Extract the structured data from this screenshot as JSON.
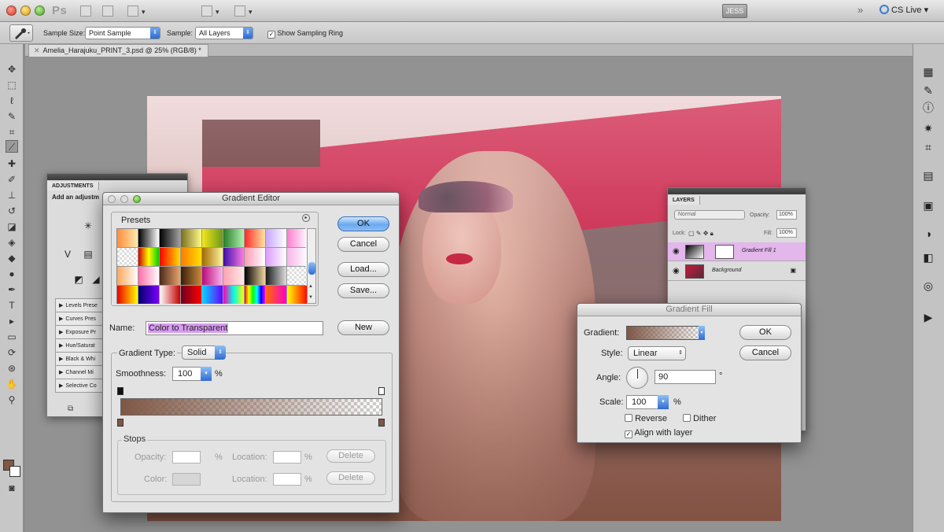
{
  "app": {
    "logo": "Ps",
    "workspace": "JESS",
    "cs_live": "CS Live"
  },
  "options_bar": {
    "sample_size_label": "Sample Size:",
    "sample_size_value": "Point Sample",
    "sample_label": "Sample:",
    "sample_value": "All Layers",
    "show_sampling_ring": "Show Sampling Ring",
    "show_sampling_ring_checked": true
  },
  "document": {
    "tab_title": "Amelia_Harajuku_PRINT_3.psd @ 25% (RGB/8) *"
  },
  "adjustments": {
    "tab": "ADJUSTMENTS",
    "hint": "Add an adjustm",
    "presets": [
      "Levels Prese",
      "Curves Pres",
      "Exposure Pr",
      "Hue/Saturat",
      "Black & Whi",
      "Channel Mi",
      "Selective Co"
    ]
  },
  "gradient_editor": {
    "title": "Gradient Editor",
    "presets_label": "Presets",
    "ok": "OK",
    "cancel": "Cancel",
    "load": "Load...",
    "save": "Save...",
    "name_label": "Name:",
    "name_value": "Color to Transparent",
    "new_button": "New",
    "gradient_type_label": "Gradient Type:",
    "gradient_type_value": "Solid",
    "smoothness_label": "Smoothness:",
    "smoothness_value": "100",
    "percent": "%",
    "stops_label": "Stops",
    "opacity_label": "Opacity:",
    "color_label": "Color:",
    "location_label": "Location:",
    "delete": "Delete",
    "gradient_color": "#7e5746",
    "preset_swatches": [
      "linear-gradient(90deg,#ff8d3a,#ffe9b0)",
      "linear-gradient(90deg,#000,#fff)",
      "linear-gradient(90deg,#000,#a1a1a1)",
      "linear-gradient(90deg,#7a6e1e,#fffa8a)",
      "linear-gradient(90deg,#f4e61a,#6d9a1a)",
      "linear-gradient(90deg,#2a7d2a,#b1f3b1)",
      "linear-gradient(90deg,#ff2a2a,#ffe5a0)",
      "linear-gradient(90deg,#c8a6ff,#fff)",
      "linear-gradient(90deg,#ff7dd0,#fff)",
      "repeating-conic-gradient(#ddd 0% 25%,#fff 0% 50%) 0 0/6px 6px",
      "linear-gradient(90deg,#c00,#ff0,#0c0)",
      "linear-gradient(90deg,#ff0000,#ffde00)",
      "linear-gradient(90deg,#ff7a00,#ffe000)",
      "linear-gradient(90deg,#a36b00,#fff3a0)",
      "linear-gradient(90deg,#3b0fa8,#ff7ae6)",
      "linear-gradient(90deg,#ff9ab5,#fff)",
      "linear-gradient(90deg,#dc9bff,#fff)",
      "linear-gradient(90deg,#f7b4e9,#fff)",
      "linear-gradient(90deg,#ffa75c,#fff)",
      "linear-gradient(90deg,#ff6ea8,#fff)",
      "linear-gradient(90deg,#4b2a1a,#e8a36b)",
      "linear-gradient(90deg,#3b1d0a,#c78a3c)",
      "linear-gradient(90deg,#b70b7b,#ffb1ec)",
      "linear-gradient(90deg,#ffa3b0,#ffe9e9)",
      "linear-gradient(90deg,#000,#f0d4a0)",
      "linear-gradient(90deg,#1c1c1c,#ddd)",
      "repeating-conic-gradient(#ddd 0% 25%,#fff 0% 50%) 0 0/6px 6px",
      "linear-gradient(90deg,#e00,#ff0)",
      "linear-gradient(90deg,#00006b,#7a00ff)",
      "linear-gradient(90deg,#fff,#c40000)",
      "linear-gradient(90deg,#6b0020,#ff0000)",
      "linear-gradient(90deg,#00d9ff,#6b00ff)",
      "linear-gradient(90deg,#ff00ae,#00ffe6,#ff0)",
      "linear-gradient(90deg,#f00,#ff0,#0f0,#0ff,#00f,#f0f)",
      "linear-gradient(90deg,#ff6a00,#ff00c8)",
      "linear-gradient(90deg,#ff0,#f00)"
    ]
  },
  "layers": {
    "tab": "LAYERS",
    "blend_mode": "Normal",
    "opacity_label": "Opacity:",
    "opacity_value": "100%",
    "lock_label": "Lock:",
    "fill_label": "Fill:",
    "fill_value": "100%",
    "items": [
      {
        "name": "Gradient Fill 1"
      },
      {
        "name": "Background"
      }
    ]
  },
  "gradient_fill": {
    "title": "Gradient Fill",
    "gradient_label": "Gradient:",
    "style_label": "Style:",
    "style_value": "Linear",
    "angle_label": "Angle:",
    "angle_value": "90",
    "degree": "°",
    "scale_label": "Scale:",
    "scale_value": "100",
    "percent": "%",
    "reverse": "Reverse",
    "dither": "Dither",
    "align_with_layer": "Align with layer",
    "ok": "OK",
    "cancel": "Cancel"
  }
}
